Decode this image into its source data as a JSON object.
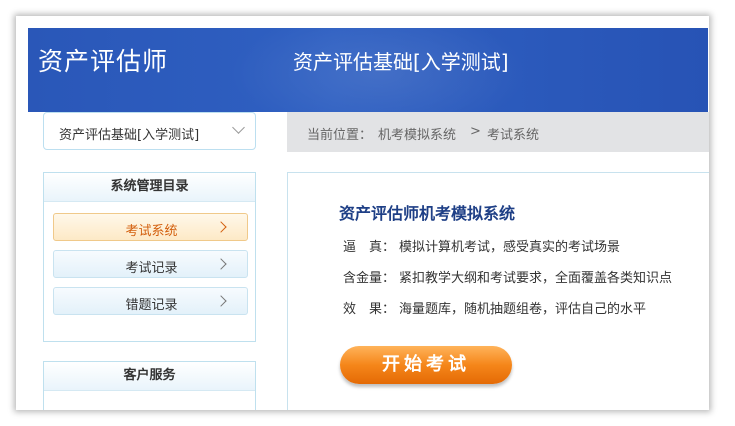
{
  "header": {
    "app_title": "资产评估师",
    "page_heading": "资产评估基础[入学测试]"
  },
  "subject_select": {
    "value": "资产评估基础[入学测试]"
  },
  "breadcrumb": {
    "prefix": "当前位置：",
    "items": [
      "机考模拟系统",
      "考试系统"
    ],
    "separator": ">"
  },
  "sidebar": {
    "title": "系统管理目录",
    "items": [
      {
        "label": "考试系统",
        "active": true
      },
      {
        "label": "考试记录",
        "active": false
      },
      {
        "label": "错题记录",
        "active": false
      }
    ],
    "service_title": "客户服务"
  },
  "main": {
    "title": "资产评估师机考模拟系统",
    "features": [
      {
        "key": "逼　真：",
        "text": "模拟计算机考试，感受真实的考试场景"
      },
      {
        "key": "含金量：",
        "text": "紧扣教学大纲和考试要求，全面覆盖各类知识点"
      },
      {
        "key": "效　果：",
        "text": "海量题库，随机抽题组卷，评估自己的水平"
      }
    ],
    "start_button": "开始考试"
  },
  "colors": {
    "header_blue": "#2a57b8",
    "active_orange": "#d35f0d",
    "button_orange": "#f5861a",
    "title_blue": "#1e3f86"
  }
}
